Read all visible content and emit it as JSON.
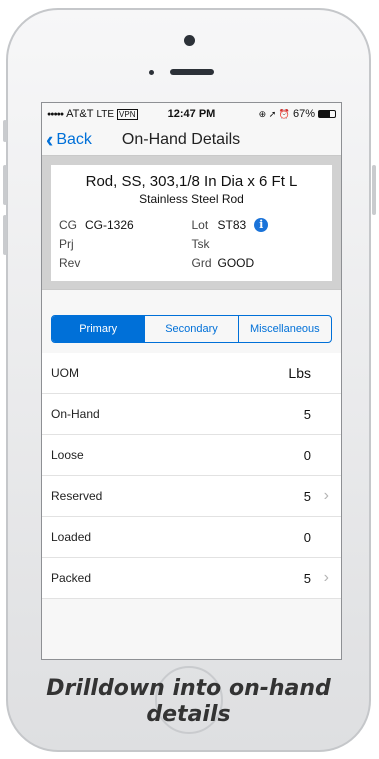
{
  "status_bar": {
    "signal": "●●●●●",
    "carrier": "AT&T",
    "network": "LTE",
    "vpn": "VPN",
    "time": "12:47 PM",
    "right_icons": "⊕ ➚ ⏰",
    "battery_percent": "67%",
    "battery_level": 0.67
  },
  "nav": {
    "back_label": "Back",
    "title": "On-Hand Details"
  },
  "item": {
    "title": "Rod, SS, 303,1/8 In Dia x 6 Ft L",
    "subtitle": "Stainless Steel Rod",
    "fields": {
      "cg_label": "CG",
      "cg_value": "CG-1326",
      "lot_label": "Lot",
      "lot_value": "ST83",
      "prj_label": "Prj",
      "prj_value": "",
      "tsk_label": "Tsk",
      "tsk_value": "",
      "rev_label": "Rev",
      "rev_value": "",
      "grd_label": "Grd",
      "grd_value": "GOOD"
    },
    "info_icon_glyph": "i"
  },
  "tabs": [
    {
      "label": "Primary",
      "active": true
    },
    {
      "label": "Secondary",
      "active": false
    },
    {
      "label": "Miscellaneous",
      "active": false
    }
  ],
  "rows": [
    {
      "label": "UOM",
      "value": "Lbs",
      "chevron": ""
    },
    {
      "label": "On-Hand",
      "value": "5",
      "chevron": ""
    },
    {
      "label": "Loose",
      "value": "0",
      "chevron": ""
    },
    {
      "label": "Reserved",
      "value": "5",
      "chevron": "›"
    },
    {
      "label": "Loaded",
      "value": "0",
      "chevron": ""
    },
    {
      "label": "Packed",
      "value": "5",
      "chevron": "›"
    }
  ],
  "caption": "Drilldown into on-hand details",
  "colors": {
    "accent": "#0070d8",
    "info_icon": "#1a73d9"
  }
}
